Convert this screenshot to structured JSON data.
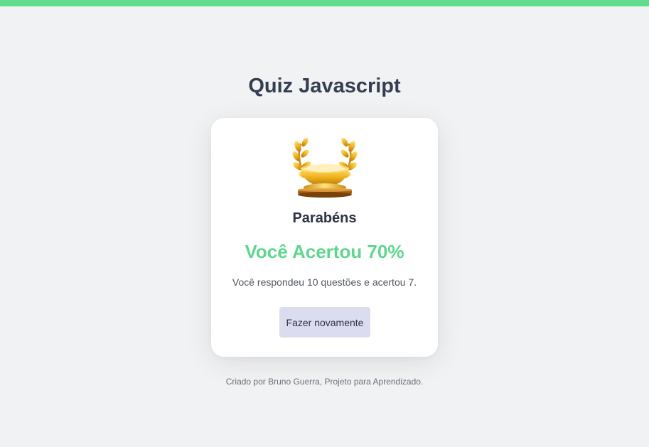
{
  "app": {
    "title": "Quiz Javascript",
    "accent_color": "#5fdc8d"
  },
  "result": {
    "icon": "trophy-icon",
    "heading": "Parabéns",
    "score_text": "Você Acertou 70%",
    "score_percent": 70,
    "summary": "Você respondeu 10 questões e acertou 7.",
    "questions_total": 10,
    "questions_correct": 7,
    "retry_label": "Fazer novamente"
  },
  "footer": {
    "text": "Criado por Bruno Guerra, Projeto para Aprendizado."
  }
}
